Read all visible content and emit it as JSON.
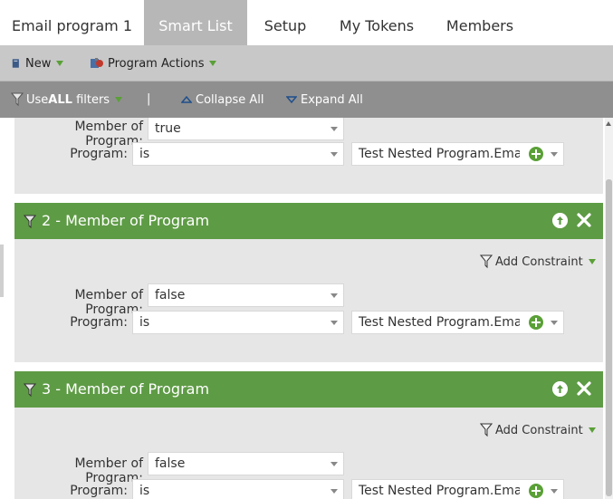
{
  "tabs": [
    {
      "label": "Email program 1",
      "active": false
    },
    {
      "label": "Smart List",
      "active": true
    },
    {
      "label": "Setup",
      "active": false
    },
    {
      "label": "My Tokens",
      "active": false
    },
    {
      "label": "Members",
      "active": false
    }
  ],
  "toolbar": {
    "new_label": "New",
    "program_actions_label": "Program Actions"
  },
  "filterbar": {
    "use_prefix": "Use ",
    "use_all": "ALL",
    "use_suffix": " filters",
    "separator": "|",
    "collapse_all": "Collapse All",
    "expand_all": "Expand All"
  },
  "filters": [
    {
      "title": "",
      "member_label": "Member of Program:",
      "member_value": "true",
      "program_label": "Program:",
      "operator": "is",
      "program_value": "Test Nested Program.Email p"
    },
    {
      "title": "2 - Member of Program",
      "add_constraint": "Add Constraint",
      "member_label": "Member of Program:",
      "member_value": "false",
      "program_label": "Program:",
      "operator": "is",
      "program_value": "Test Nested Program.Email I"
    },
    {
      "title": "3 - Member of Program",
      "add_constraint": "Add Constraint",
      "member_label": "Member of Program:",
      "member_value": "false",
      "program_label": "Program:",
      "operator": "is",
      "program_value": "Test Nested Program.Email p"
    }
  ],
  "colors": {
    "panel_header": "#5e9b45",
    "active_tab": "#b7b7b7",
    "accent_green": "#5aa037"
  }
}
